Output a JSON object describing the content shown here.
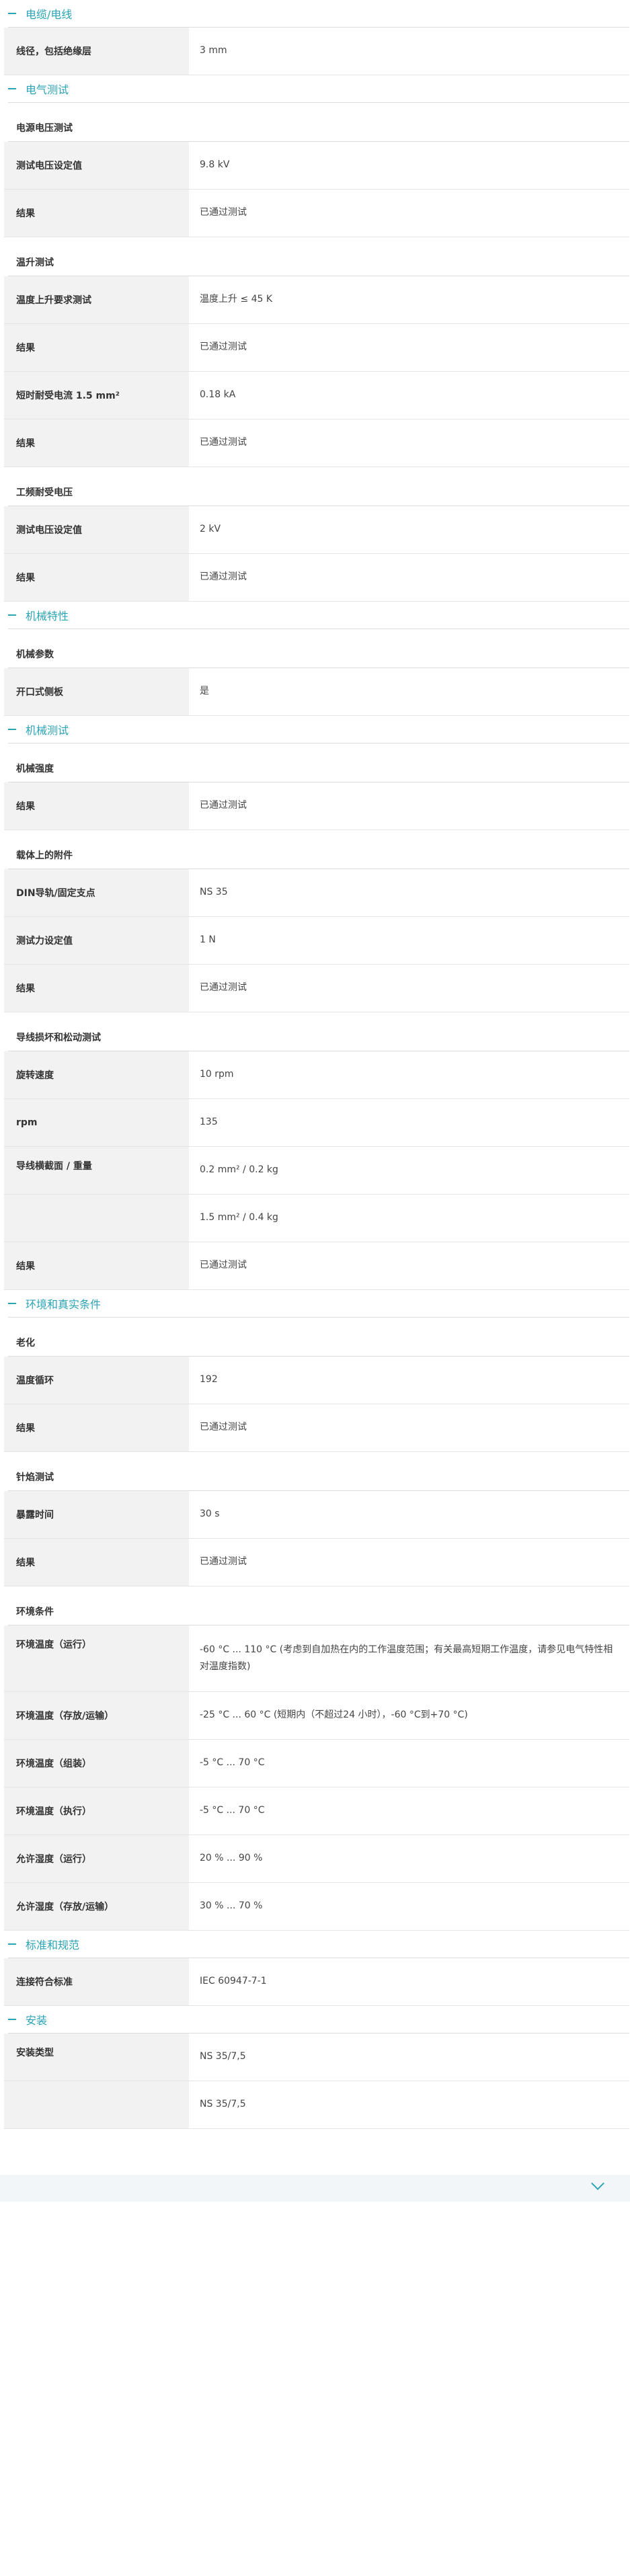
{
  "sections": [
    {
      "title": "电缆/电线",
      "groups": [
        {
          "subhead": "",
          "rows": [
            {
              "label": "线径，包括绝缘层",
              "value": "3 mm"
            }
          ]
        }
      ]
    },
    {
      "title": "电气测试",
      "groups": [
        {
          "subhead": "电源电压测试",
          "rows": [
            {
              "label": "测试电压设定值",
              "value": "9.8 kV"
            },
            {
              "label": "结果",
              "value": "已通过测试"
            }
          ]
        },
        {
          "subhead": "温升测试",
          "rows": [
            {
              "label": "温度上升要求测试",
              "value": "温度上升 ≤ 45 K"
            },
            {
              "label": "结果",
              "value": "已通过测试"
            },
            {
              "label": "短时耐受电流 1.5 mm²",
              "value": "0.18 kA"
            },
            {
              "label": "结果",
              "value": "已通过测试"
            }
          ]
        },
        {
          "subhead": "工频耐受电压",
          "rows": [
            {
              "label": "测试电压设定值",
              "value": "2 kV"
            },
            {
              "label": "结果",
              "value": "已通过测试"
            }
          ]
        }
      ]
    },
    {
      "title": "机械特性",
      "groups": [
        {
          "subhead": "机械参数",
          "rows": [
            {
              "label": "开口式侧板",
              "value": "是"
            }
          ]
        }
      ]
    },
    {
      "title": "机械测试",
      "groups": [
        {
          "subhead": "机械强度",
          "rows": [
            {
              "label": "结果",
              "value": "已通过测试"
            }
          ]
        },
        {
          "subhead": "载体上的附件",
          "rows": [
            {
              "label": "DIN导轨/固定支点",
              "value": "NS 35"
            },
            {
              "label": "测试力设定值",
              "value": "1 N"
            },
            {
              "label": "结果",
              "value": "已通过测试"
            }
          ]
        },
        {
          "subhead": "导线损坏和松动测试",
          "rows": [
            {
              "label": "旋转速度",
              "value": "10 rpm"
            },
            {
              "label": "rpm",
              "value": "135"
            },
            {
              "label": "导线横截面 / 重量",
              "value": "0.2 mm² / 0.2 kg",
              "top": true
            },
            {
              "label": "",
              "value": "1.5 mm² / 0.4 kg"
            },
            {
              "label": "结果",
              "value": "已通过测试"
            }
          ]
        }
      ]
    },
    {
      "title": "环境和真实条件",
      "groups": [
        {
          "subhead": "老化",
          "rows": [
            {
              "label": "温度循环",
              "value": "192"
            },
            {
              "label": "结果",
              "value": "已通过测试"
            }
          ]
        },
        {
          "subhead": "针焰测试",
          "rows": [
            {
              "label": "暴露时间",
              "value": "30 s"
            },
            {
              "label": "结果",
              "value": "已通过测试"
            }
          ]
        },
        {
          "subhead": "环境条件",
          "rows": [
            {
              "label": "环境温度（运行）",
              "value": "-60 °C ... 110 °C (考虑到自加热在内的工作温度范围；有关最高短期工作温度，请参见电气特性相对温度指数)",
              "top": true,
              "tall": true
            },
            {
              "label": "环境温度（存放/运输）",
              "value": "-25 °C ... 60 °C (短期内（不超过24 小时），-60 °C到+70 °C)"
            },
            {
              "label": "环境温度（组装）",
              "value": "-5 °C ... 70 °C"
            },
            {
              "label": "环境温度（执行）",
              "value": "-5 °C ... 70 °C"
            },
            {
              "label": "允许湿度（运行）",
              "value": "20 % ... 90 %"
            },
            {
              "label": "允许湿度（存放/运输）",
              "value": "30 % ... 70 %"
            }
          ]
        }
      ]
    },
    {
      "title": "标准和规范",
      "groups": [
        {
          "subhead": "",
          "rows": [
            {
              "label": "连接符合标准",
              "value": "IEC 60947-7-1"
            }
          ]
        }
      ]
    },
    {
      "title": "安装",
      "groups": [
        {
          "subhead": "",
          "rows": [
            {
              "label": "安装类型",
              "value": "NS 35/7,5",
              "top": true
            },
            {
              "label": "",
              "value": "NS 35/7,5"
            }
          ]
        }
      ]
    }
  ],
  "footer": {
    "icon": "chevron-down-icon"
  },
  "colors": {
    "accent": "#2aa3b4",
    "label_bg": "#f2f2f2"
  }
}
